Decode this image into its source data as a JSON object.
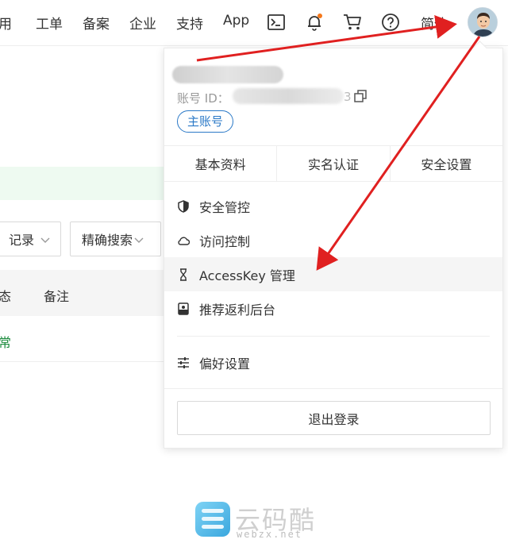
{
  "topnav": {
    "items": [
      {
        "label": "用"
      },
      {
        "label": "工单"
      },
      {
        "label": "备案"
      },
      {
        "label": "企业"
      },
      {
        "label": "支持"
      },
      {
        "label": "App"
      }
    ],
    "language": "简体",
    "notification_dot_color": "#f5781a"
  },
  "background_page": {
    "filter_select_1": "记录",
    "filter_select_2": "精确搜索",
    "table_headers": [
      "态",
      "备注"
    ],
    "table_row_status": "常"
  },
  "account_panel": {
    "id_label": "账号 ID：",
    "id_suffix": "3",
    "account_badge": "主账号",
    "tabs": [
      "基本资料",
      "实名认证",
      "安全设置"
    ],
    "menu": [
      {
        "label": "安全管控",
        "icon": "shield-icon"
      },
      {
        "label": "访问控制",
        "icon": "cloud-icon"
      },
      {
        "label": "AccessKey 管理",
        "icon": "key-icon"
      },
      {
        "label": "推荐返利后台",
        "icon": "card-icon"
      }
    ],
    "preferences": {
      "label": "偏好设置",
      "icon": "sliders-icon"
    },
    "logout_label": "退出登录"
  },
  "annotation_color": "#e02020",
  "watermark": {
    "title": "云码酷",
    "url": "webzx.net"
  }
}
